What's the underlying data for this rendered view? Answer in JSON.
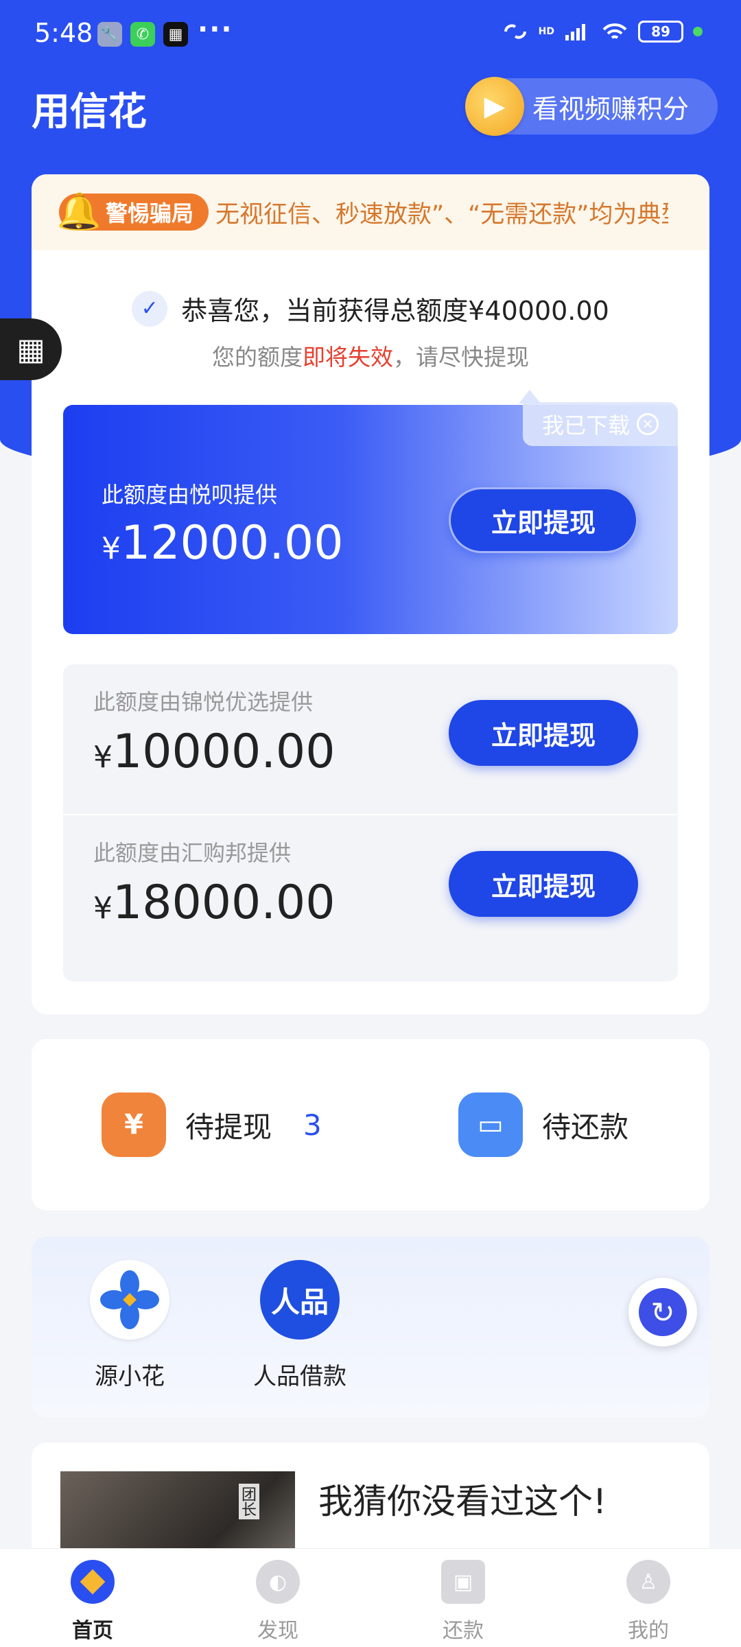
{
  "status_bar": {
    "time": "5:48",
    "battery": "89",
    "network": "HD",
    "more": "···"
  },
  "header": {
    "title": "用信花",
    "video_button": "看视频赚积分"
  },
  "warning": {
    "badge": "警惕骗局",
    "text": "无视征信、秒速放款”、“无需还款”均为典型"
  },
  "summary": {
    "congrats": "恭喜您，当前获得总额度¥40000.00",
    "expire_prefix": "您的额度",
    "expire_highlight": "即将失效",
    "expire_suffix": "，请尽快提现"
  },
  "offers": [
    {
      "provider": "此额度由悦呗提供",
      "yen": "¥",
      "amount": "12000.00",
      "button": "立即提现",
      "tag": "我已下载"
    },
    {
      "provider": "此额度由锦悦优选提供",
      "yen": "¥",
      "amount": "10000.00",
      "button": "立即提现"
    },
    {
      "provider": "此额度由汇购邦提供",
      "yen": "¥",
      "amount": "18000.00",
      "button": "立即提现"
    }
  ],
  "pending": {
    "withdraw_label": "待提现",
    "withdraw_count": "3",
    "repay_label": "待还款"
  },
  "partners": [
    {
      "name": "源小花",
      "icon": "flower-logo-icon"
    },
    {
      "name": "人品借款",
      "icon": "renpin-logo-icon",
      "logo_text": "人品"
    }
  ],
  "video": {
    "title": "我猜你没看过这个!",
    "caption": "团长"
  },
  "nav": [
    {
      "label": "首页",
      "icon": "home-icon",
      "active": true
    },
    {
      "label": "发现",
      "icon": "discover-icon",
      "active": false
    },
    {
      "label": "还款",
      "icon": "repay-icon",
      "active": false
    },
    {
      "label": "我的",
      "icon": "profile-icon",
      "active": false
    }
  ],
  "colors": {
    "primary": "#2a4ff0",
    "warning": "#f07a2b",
    "highlight_red": "#e6402f"
  }
}
